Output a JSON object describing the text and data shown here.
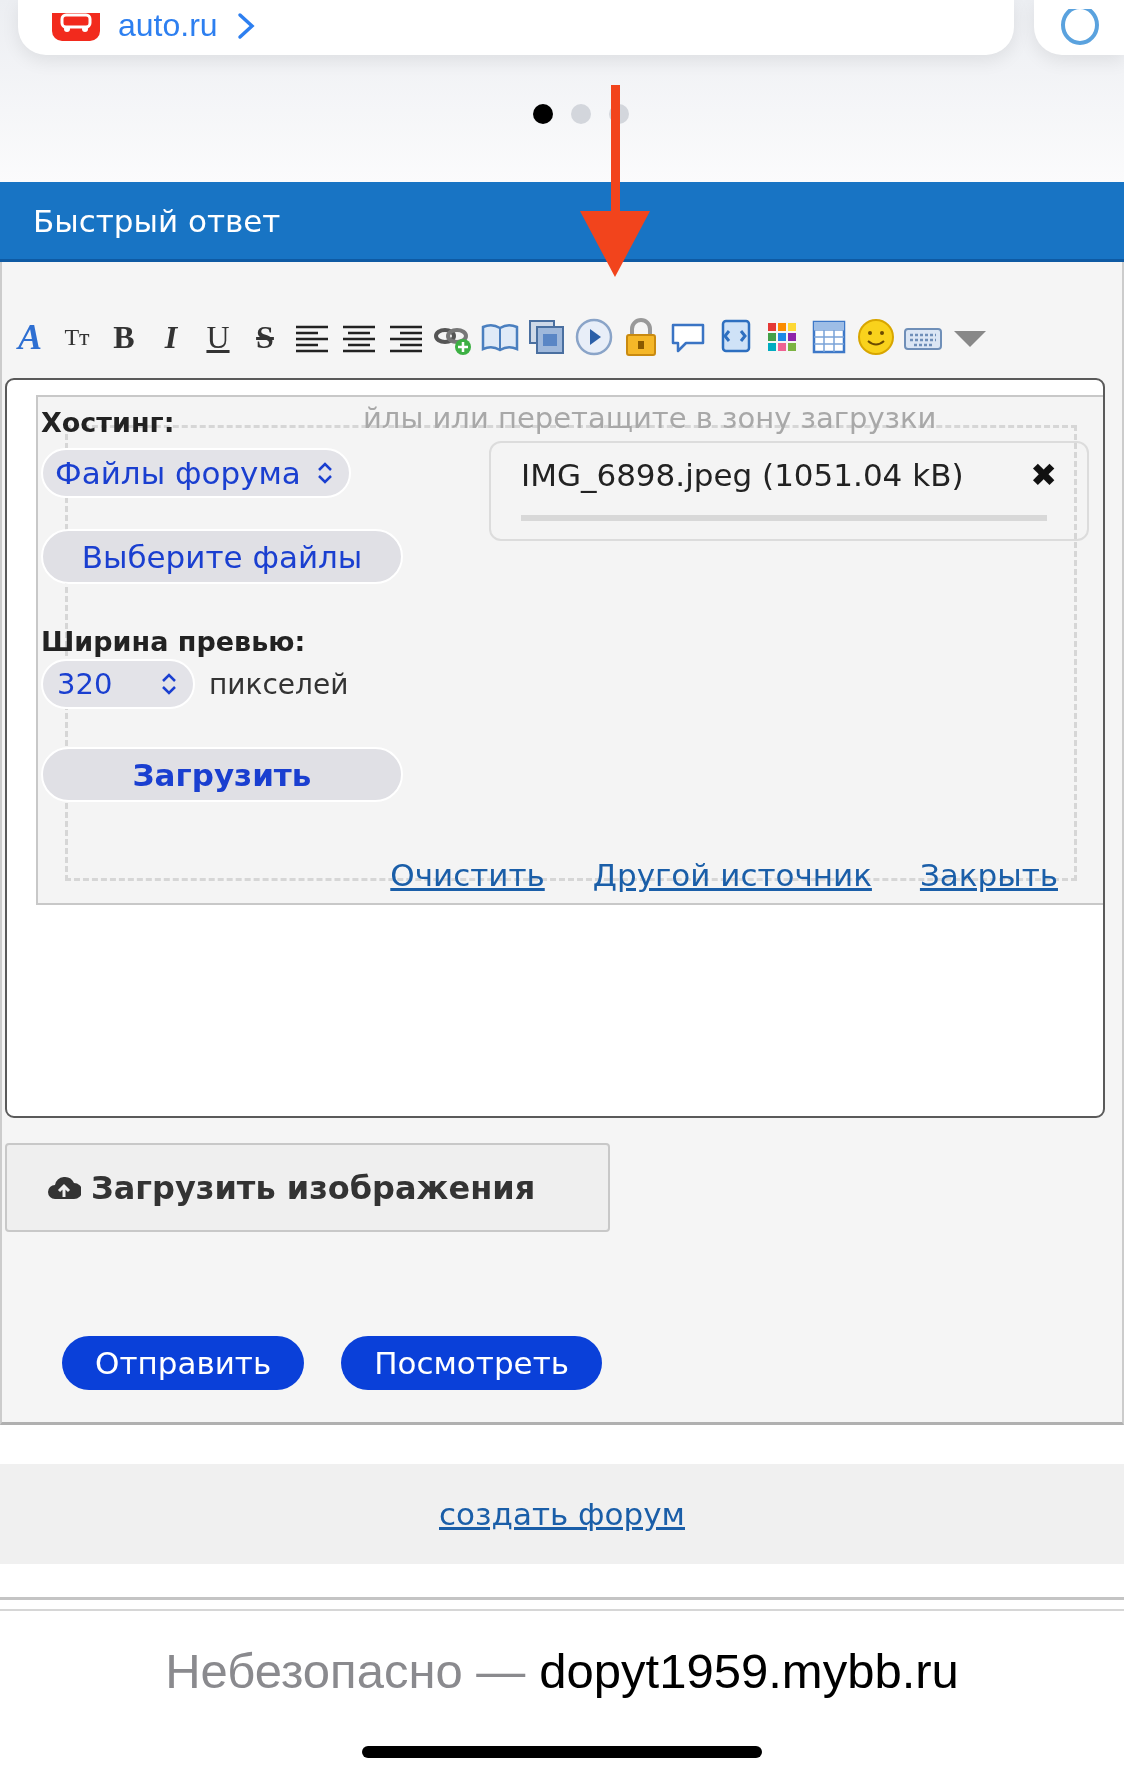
{
  "carousel": {
    "card_link": "auto.ru",
    "dots": [
      {
        "selected": true
      },
      {
        "selected": false
      },
      {
        "selected": false
      }
    ]
  },
  "quick_reply": {
    "title": "Быстрый ответ",
    "toolbar": [
      {
        "kind": "color-letter",
        "text": "A"
      },
      {
        "kind": "size-letters",
        "text": "Tт"
      },
      {
        "kind": "bold",
        "text": "B"
      },
      {
        "kind": "italic",
        "text": "I"
      },
      {
        "kind": "underline",
        "text": "U"
      },
      {
        "kind": "strike",
        "text": "S"
      },
      {
        "kind": "align-left"
      },
      {
        "kind": "align-center"
      },
      {
        "kind": "align-right"
      },
      {
        "kind": "link"
      },
      {
        "kind": "book"
      },
      {
        "kind": "gallery"
      },
      {
        "kind": "play"
      },
      {
        "kind": "lock"
      },
      {
        "kind": "speech"
      },
      {
        "kind": "script"
      },
      {
        "kind": "colors"
      },
      {
        "kind": "table"
      },
      {
        "kind": "smiley"
      },
      {
        "kind": "keyboard"
      },
      {
        "kind": "more"
      }
    ],
    "upload": {
      "hosting_label": "Хостинг:",
      "hosting_select": "Файлы форума",
      "drop_hint": "йлы или перетащите в зону загрузки",
      "file_name": "IMG_6898.jpeg (1051.04 kB)",
      "file_remove": "✖",
      "choose_button": "Выберите файлы",
      "width_label": "Ширина превью:",
      "width_select": "320",
      "width_unit": "пикселей",
      "upload_button": "Загрузить",
      "links": [
        "Очистить",
        "Другой источник",
        "Закрыть"
      ]
    },
    "upload_images_button": "Загрузить изображения",
    "buttons": [
      "Отправить",
      "Посмотреть"
    ]
  },
  "footer": {
    "link": "создать форум"
  },
  "address_bar": {
    "security": "Небезопасно —",
    "domain": "dopyt1959.mybb.ru"
  }
}
